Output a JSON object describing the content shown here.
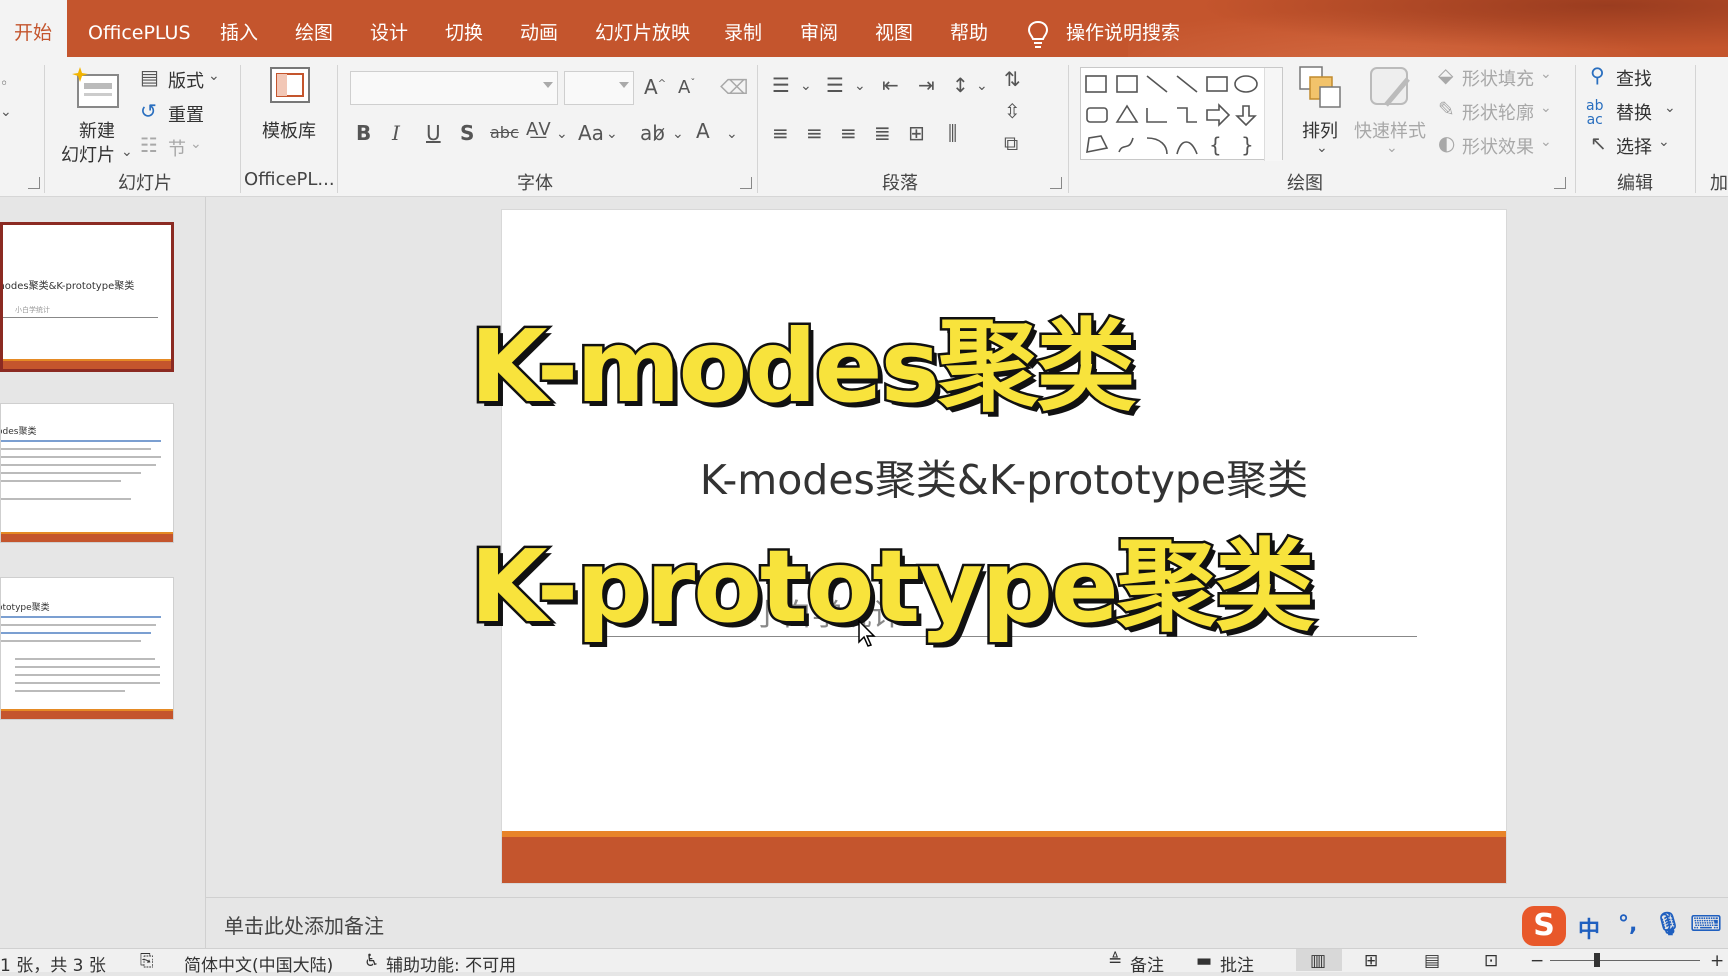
{
  "tabs": [
    {
      "label": "开始",
      "active": true
    },
    {
      "label": "OfficePLUS"
    },
    {
      "label": "插入"
    },
    {
      "label": "绘图"
    },
    {
      "label": "设计"
    },
    {
      "label": "切换"
    },
    {
      "label": "动画"
    },
    {
      "label": "幻灯片放映"
    },
    {
      "label": "录制"
    },
    {
      "label": "审阅"
    },
    {
      "label": "视图"
    },
    {
      "label": "帮助"
    }
  ],
  "search_hint": "操作说明搜索",
  "ribbon": {
    "slides": {
      "new_slide": "新建",
      "new_slide_2": "幻灯片",
      "layout": "版式",
      "reset": "重置",
      "section": "节",
      "label": "幻灯片"
    },
    "officeplus": {
      "template_lib": "模板库",
      "label": "OfficePL..."
    },
    "font": {
      "label": "字体"
    },
    "paragraph": {
      "label": "段落"
    },
    "drawing": {
      "arrange": "排列",
      "quick_styles": "快速样式",
      "shape_fill": "形状填充",
      "shape_outline": "形状轮廓",
      "shape_effect": "形状效果",
      "label": "绘图"
    },
    "editing": {
      "find": "查找",
      "replace": "替换",
      "select": "选择",
      "label": "编辑"
    },
    "addin_label": "加"
  },
  "thumbnails": [
    {
      "title": "modes聚类&K-prototype聚类",
      "sub": "小白学统计"
    },
    {
      "title": "odes聚类"
    },
    {
      "title": "ototype聚类"
    }
  ],
  "slide": {
    "subtitle": "K-modes聚类&K-prototype聚类",
    "author": "小白学统计",
    "overlay_1": "K-modes聚类",
    "overlay_2": "K-prototype聚类"
  },
  "notes_placeholder": "单击此处添加备注",
  "status": {
    "slide_count": "1 张，共 3 张",
    "language": "简体中文(中国大陆)",
    "accessibility": "辅助功能: 不可用",
    "notes": "备注",
    "comments": "批注"
  },
  "ime": {
    "lang": "中",
    "punct": "°,"
  },
  "colors": {
    "accent": "#c4552d",
    "accent_light": "#e8842a",
    "overlay_fill": "#f8e33c"
  }
}
